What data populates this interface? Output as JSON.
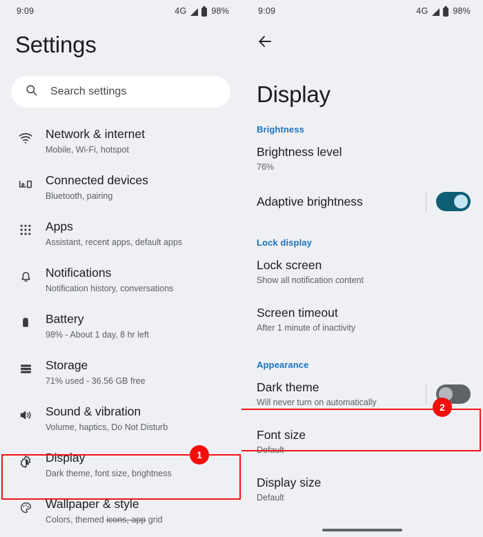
{
  "status_bar": {
    "time": "9:09",
    "network": "4G",
    "battery": "98%"
  },
  "settings_screen": {
    "title": "Settings",
    "search": {
      "placeholder": "Search settings",
      "icon": "search-icon"
    },
    "items": [
      {
        "icon": "wifi-icon",
        "title": "Network & internet",
        "subtitle": "Mobile, Wi-Fi, hotspot"
      },
      {
        "icon": "connected-devices-icon",
        "title": "Connected devices",
        "subtitle": "Bluetooth, pairing"
      },
      {
        "icon": "apps-grid-icon",
        "title": "Apps",
        "subtitle": "Assistant, recent apps, default apps"
      },
      {
        "icon": "bell-icon",
        "title": "Notifications",
        "subtitle": "Notification history, conversations"
      },
      {
        "icon": "battery-icon",
        "title": "Battery",
        "subtitle": "98% - About 1 day, 8 hr left"
      },
      {
        "icon": "storage-icon",
        "title": "Storage",
        "subtitle": "71% used - 36.56 GB free"
      },
      {
        "icon": "volume-icon",
        "title": "Sound & vibration",
        "subtitle": "Volume, haptics, Do Not Disturb"
      },
      {
        "icon": "brightness-icon",
        "title": "Display",
        "subtitle": "Dark theme, font size, brightness"
      },
      {
        "icon": "palette-icon",
        "title": "Wallpaper & style",
        "subtitle_a": "Colors, themed",
        "subtitle_b": "icons, app",
        "subtitle_c": "grid"
      }
    ]
  },
  "display_screen": {
    "back_icon": "back-arrow-icon",
    "title": "Display",
    "sections": [
      {
        "header": "Brightness",
        "rows": [
          {
            "title": "Brightness level",
            "subtitle": "76%",
            "control": "none"
          },
          {
            "title": "Adaptive brightness",
            "subtitle": "",
            "control": "toggle",
            "toggle_state": "on"
          }
        ]
      },
      {
        "header": "Lock display",
        "rows": [
          {
            "title": "Lock screen",
            "subtitle": "Show all notification content",
            "control": "none"
          },
          {
            "title": "Screen timeout",
            "subtitle": "After 1 minute of inactivity",
            "control": "none"
          }
        ]
      },
      {
        "header": "Appearance",
        "rows": [
          {
            "title": "Dark theme",
            "subtitle": "Will never turn on automatically",
            "control": "toggle",
            "toggle_state": "off"
          },
          {
            "title": "Font size",
            "subtitle": "Default",
            "control": "none"
          },
          {
            "title": "Display size",
            "subtitle": "Default",
            "control": "none"
          }
        ]
      }
    ]
  },
  "annotations": {
    "accent_color": "#f40d0d",
    "badges": [
      {
        "label": "1",
        "target": "display-settings-row"
      },
      {
        "label": "2",
        "target": "dark-theme-row"
      }
    ]
  }
}
